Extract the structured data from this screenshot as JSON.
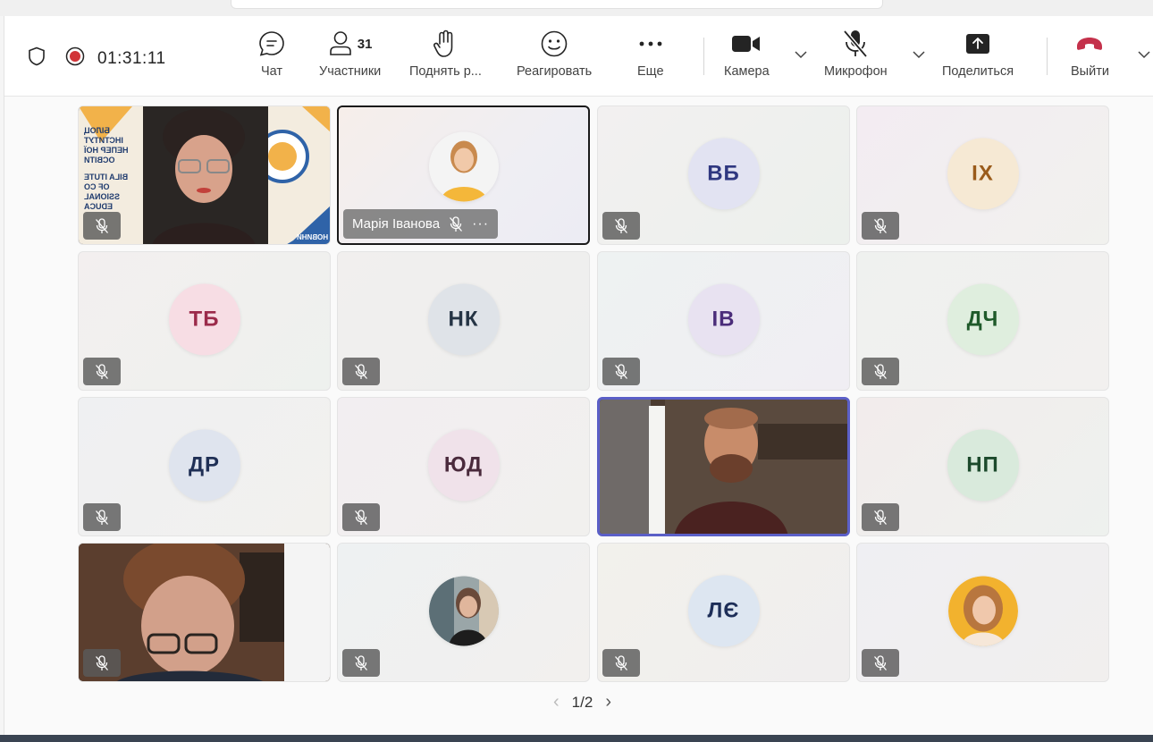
{
  "toolbar": {
    "timer": "01:31:11",
    "chat_label": "Чат",
    "participants_label": "Участники",
    "participants_count": "31",
    "raise_hand_label": "Поднять р...",
    "react_label": "Реагировать",
    "more_label": "Еще",
    "camera_label": "Камера",
    "mic_label": "Микрофон",
    "share_label": "Поделиться",
    "leave_label": "Выйти"
  },
  "tiles": {
    "t1": {
      "kind": "video",
      "banner_line1": "БІЛОЦ ІНСТИТУТ",
      "banner_line2": "НЕПЕР НОЇ ОСВІТИ",
      "banner_line3": "BILA ITUTE",
      "banner_line4": "OF CO SSIONAL",
      "banner_line5": "EDUCA",
      "banner_tag": "НОВИНИ"
    },
    "t2": {
      "kind": "photo",
      "name": "Марія Іванова"
    },
    "t3": {
      "initials": "ВБ"
    },
    "t4": {
      "initials": "ІХ"
    },
    "t5": {
      "initials": "ТБ"
    },
    "t6": {
      "initials": "НК"
    },
    "t7": {
      "initials": "ІВ"
    },
    "t8": {
      "initials": "ДЧ"
    },
    "t9": {
      "initials": "ДР"
    },
    "t10": {
      "initials": "ЮД"
    },
    "t11": {
      "kind": "video"
    },
    "t12": {
      "initials": "НП"
    },
    "t13": {
      "kind": "video"
    },
    "t14": {
      "kind": "photo"
    },
    "t15": {
      "initials": "ЛЄ"
    },
    "t16": {
      "kind": "photo"
    }
  },
  "pagination": {
    "current": "1/2"
  },
  "colors": {
    "accent": "#5b5fc7",
    "record": "#d13438",
    "leave": "#c4314b",
    "muted_bg": "#5a5a5a"
  }
}
